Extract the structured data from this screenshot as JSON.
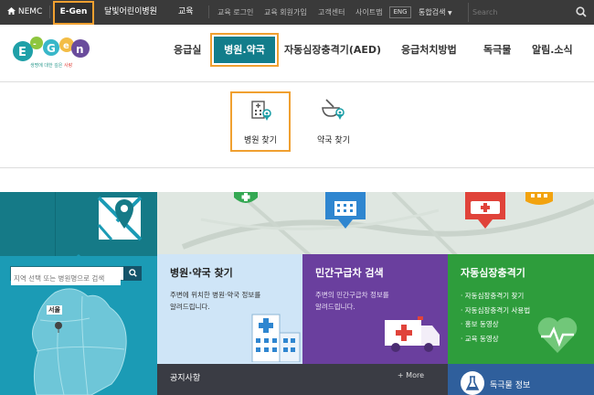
{
  "topbar": {
    "nemc": "NEMC",
    "egen": "E-Gen",
    "moonlight": "달빛어린이병원",
    "education": "교육",
    "utility": [
      "교육 로그인",
      "교육 회원가입",
      "고객센터",
      "사이트맵"
    ],
    "lang": "ENG",
    "search_scope": "통합검색",
    "search_placeholder": "Search"
  },
  "logo": {
    "text": "E-Gen",
    "tagline_prefix": "생명에 대한 깊은 ",
    "tagline_accent": "사랑"
  },
  "nav": {
    "items": [
      "응급실",
      "병원.약국",
      "자동심장충격기(AED)",
      "응급처치방법",
      "독극물",
      "알림.소식"
    ],
    "active_index": 1
  },
  "submenu": {
    "items": [
      "병원 찾기",
      "약국 찾기"
    ],
    "active_index": 0
  },
  "region": {
    "search_placeholder": "지역 선택 또는 병원명으로 검색",
    "map_label": "서울"
  },
  "cards": {
    "hospital": {
      "title": "병원·약국 찾기",
      "desc": [
        "주변에 위치한 병원·약국 정보를",
        "알려드립니다."
      ]
    },
    "ambulance": {
      "title": "민간구급차 검색",
      "desc": [
        "주변의 민간구급차 정보를",
        "알려드립니다."
      ]
    },
    "aed": {
      "title": "자동심장충격기",
      "items": [
        "· 자동심장충격기 찾기",
        "· 자동심장충격기 사용법",
        "· 홍보 동영상",
        "· 교육 동영상"
      ]
    }
  },
  "notice": {
    "title": "공지사항",
    "more": "+ More"
  },
  "drug": {
    "title": "독극물 정보"
  },
  "colors": {
    "topbar": "#3a3a3a",
    "highlight": "#f0a030",
    "teal": "#127d8b",
    "map_blue": "#1b9bb5",
    "hospital_card": "#cfe5f7",
    "ambulance_card": "#6a3f9e",
    "aed_card": "#2e9d3c",
    "notice": "#3a3c44",
    "drug": "#2f5f9c"
  },
  "icons": [
    "home-icon",
    "search-icon",
    "hospital-building-icon",
    "pharmacy-bowl-icon",
    "map-pin-icon",
    "heartbeat-icon",
    "flask-icon",
    "ambulance-icon"
  ]
}
